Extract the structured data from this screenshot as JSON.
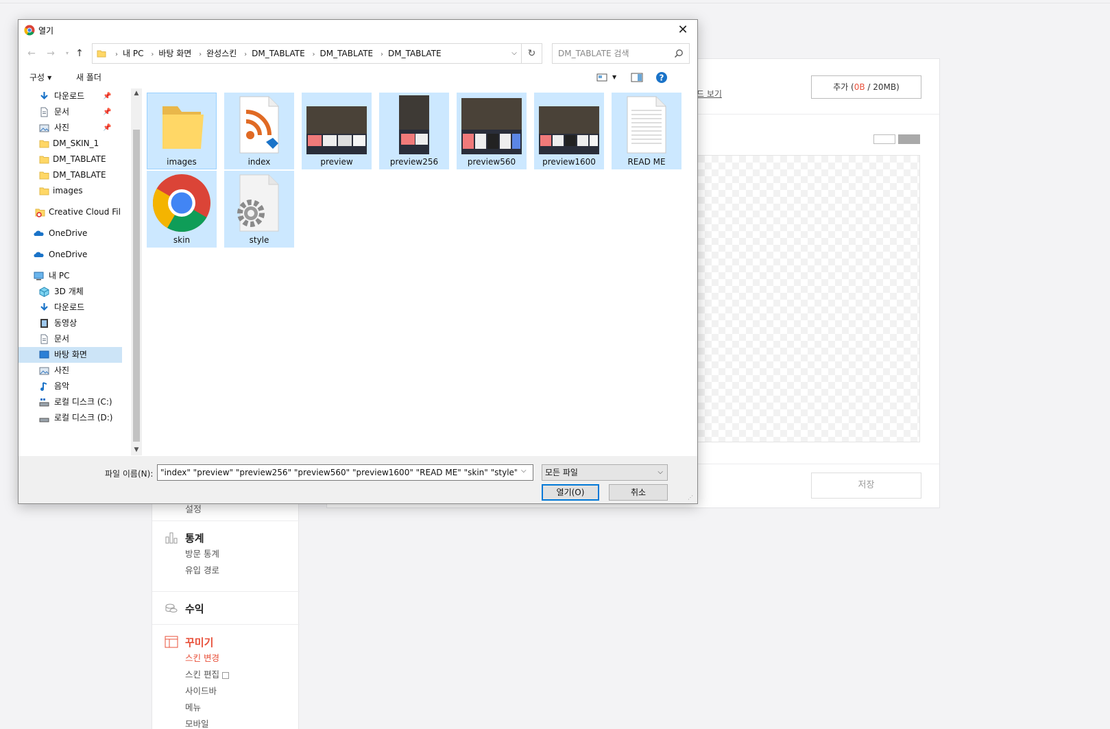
{
  "background": {
    "sidebar": {
      "fragment": "설정",
      "sections": [
        {
          "title": "통계",
          "icon": "bar-chart-icon",
          "items": [
            "방문 통계",
            "유입 경로"
          ]
        },
        {
          "title": "수익",
          "icon": "coins-icon",
          "items": []
        },
        {
          "title": "꾸미기",
          "icon": "layout-icon",
          "items": [
            "스킨 변경",
            "스킨 편집",
            "사이드바",
            "메뉴",
            "모바일"
          ]
        }
      ]
    },
    "panel": {
      "guide_link": "드 보기",
      "add_button": {
        "label": "추가 (",
        "used": "0B",
        "separator": " / ",
        "limit": "20MB",
        "close": ")"
      },
      "save_button": "저장"
    },
    "colors": {
      "accent": "#e8503a"
    }
  },
  "dialog": {
    "title": "열기",
    "close_icon": "close-icon",
    "breadcrumbs": [
      "내 PC",
      "바탕 화면",
      "완성스킨",
      "DM_TABLATE",
      "DM_TABLATE",
      "DM_TABLATE"
    ],
    "search_placeholder": "DM_TABLATE 검색",
    "commands": {
      "organize": "구성",
      "new_folder": "새 폴더"
    },
    "nav": [
      {
        "label": "다운로드",
        "icon": "download-icon",
        "pinned": true
      },
      {
        "label": "문서",
        "icon": "document-icon",
        "pinned": true
      },
      {
        "label": "사진",
        "icon": "pictures-icon",
        "pinned": true
      },
      {
        "label": "DM_SKIN_1",
        "icon": "folder-icon"
      },
      {
        "label": "DM_TABLATE",
        "icon": "folder-icon"
      },
      {
        "label": "DM_TABLATE",
        "icon": "folder-icon"
      },
      {
        "label": "images",
        "icon": "folder-icon"
      },
      {
        "label": "Creative Cloud Fil",
        "icon": "creative-cloud-icon"
      },
      {
        "label": "OneDrive",
        "icon": "onedrive-icon"
      },
      {
        "label": "OneDrive",
        "icon": "onedrive-icon"
      },
      {
        "label": "내 PC",
        "icon": "pc-icon"
      },
      {
        "label": "3D 개체",
        "icon": "cube-icon"
      },
      {
        "label": "다운로드",
        "icon": "download-icon"
      },
      {
        "label": "동영상",
        "icon": "video-icon"
      },
      {
        "label": "문서",
        "icon": "document-icon"
      },
      {
        "label": "바탕 화면",
        "icon": "desktop-icon",
        "selected": true
      },
      {
        "label": "사진",
        "icon": "pictures-icon"
      },
      {
        "label": "음악",
        "icon": "music-icon"
      },
      {
        "label": "로컬 디스크 (C:)",
        "icon": "drive-c-icon"
      },
      {
        "label": "로컬 디스크 (D:)",
        "icon": "drive-icon"
      }
    ],
    "files": [
      {
        "name": "images",
        "kind": "folder"
      },
      {
        "name": "index",
        "kind": "rss"
      },
      {
        "name": "preview",
        "kind": "image"
      },
      {
        "name": "preview256",
        "kind": "portrait"
      },
      {
        "name": "preview560",
        "kind": "image"
      },
      {
        "name": "preview1600",
        "kind": "image"
      },
      {
        "name": "READ ME",
        "kind": "text"
      },
      {
        "name": "skin",
        "kind": "chrome"
      },
      {
        "name": "style",
        "kind": "gear"
      }
    ],
    "filename_label": "파일 이름(N):",
    "filename_value": "\"index\" \"preview\" \"preview256\" \"preview560\" \"preview1600\" \"READ ME\" \"skin\" \"style\"",
    "filetype": "모든 파일",
    "open_button": "열기(O)",
    "cancel_button": "취소"
  }
}
